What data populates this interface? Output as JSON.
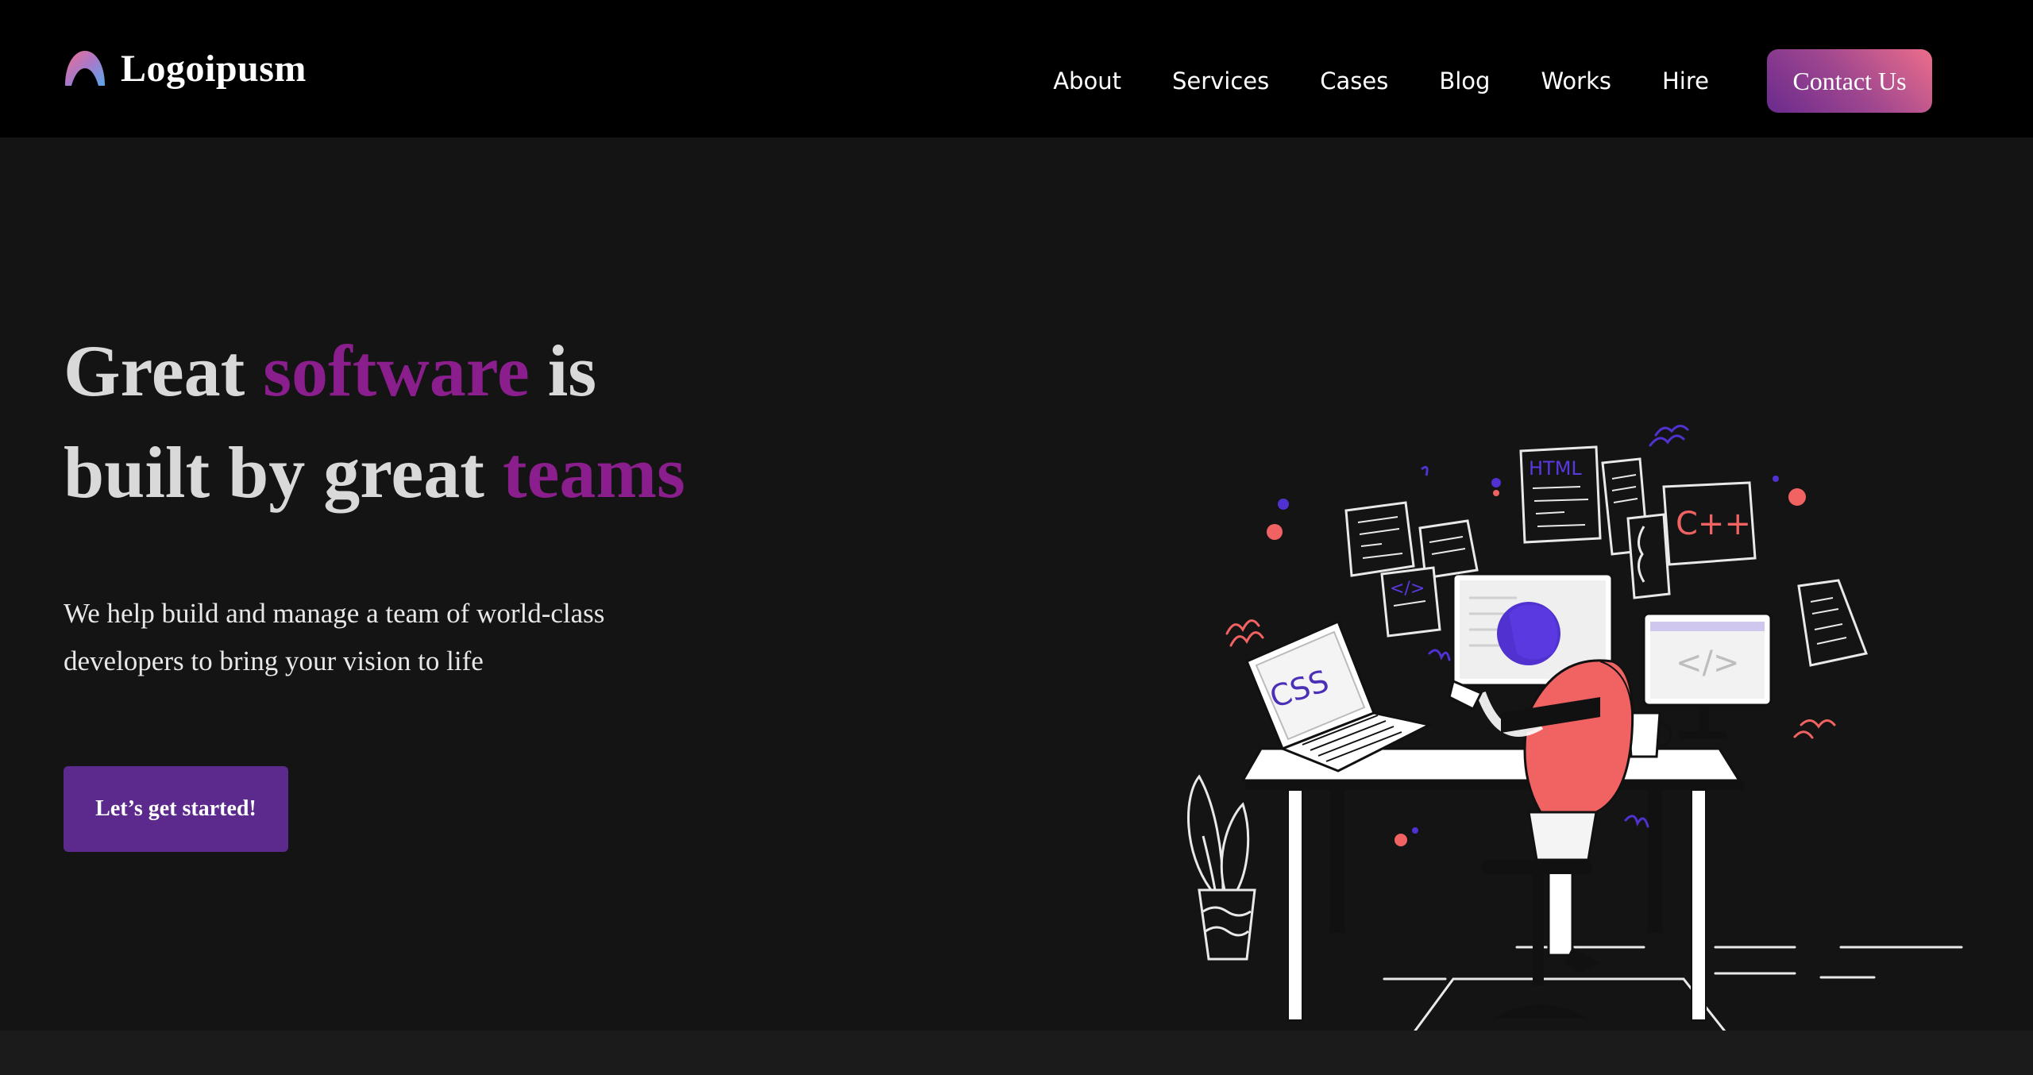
{
  "brand": {
    "name": "Logoipusm",
    "icon": "logo-arch-icon"
  },
  "nav": {
    "links": [
      "About",
      "Services",
      "Cases",
      "Blog",
      "Works",
      "Hire"
    ],
    "contact_label": "Contact Us"
  },
  "hero": {
    "headline": {
      "w1": "Great ",
      "w2": "software",
      "w3": " is",
      "w4": "built by great ",
      "w5": "teams"
    },
    "subtext": "We help build and manage a team of world-class developers to bring your vision to life",
    "cta_label": "Let’s get started!"
  },
  "illustration": {
    "icon": "developer-at-desk-illustration",
    "laptop_text": "CSS",
    "html_sheet_text": "HTML",
    "cpp_sheet_text": "C++",
    "code_tag_text": "</>"
  },
  "colors": {
    "accent": "#8a1e8c",
    "button_primary": "#5b2a8c",
    "contact_gradient_start": "#6a2a8d",
    "contact_gradient_end": "#ec6e8b",
    "navbar_bg": "#000000",
    "hero_bg": "#141414"
  }
}
